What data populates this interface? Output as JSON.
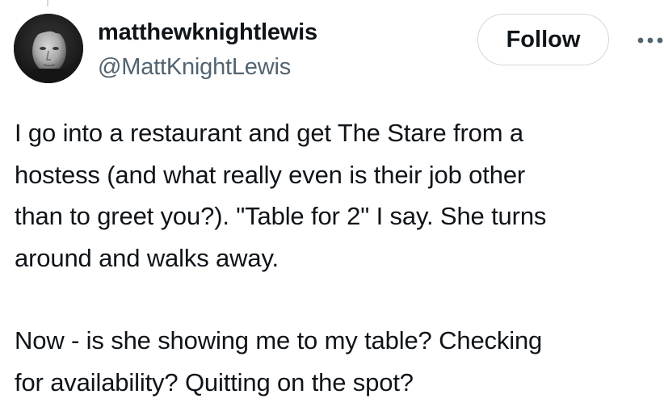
{
  "tweet": {
    "author": {
      "display_name": "matthewknightlewis",
      "handle": "@MattKnightLewis"
    },
    "follow_label": "Follow",
    "paragraphs": [
      "I go into a restaurant and get The Stare from a\nhostess (and what really even is their job other\nthan to greet you?). \"Table for 2\" I say. She turns\naround and walks away.",
      "Now - is she showing me to my table? Checking\nfor availability? Quitting on the spot?"
    ]
  },
  "icons": {
    "avatar": "profile-photo",
    "more": "more-horizontal-icon"
  },
  "colors": {
    "text_primary": "#0f1419",
    "text_secondary": "#536471",
    "border": "#cfd9de",
    "background": "#ffffff"
  }
}
